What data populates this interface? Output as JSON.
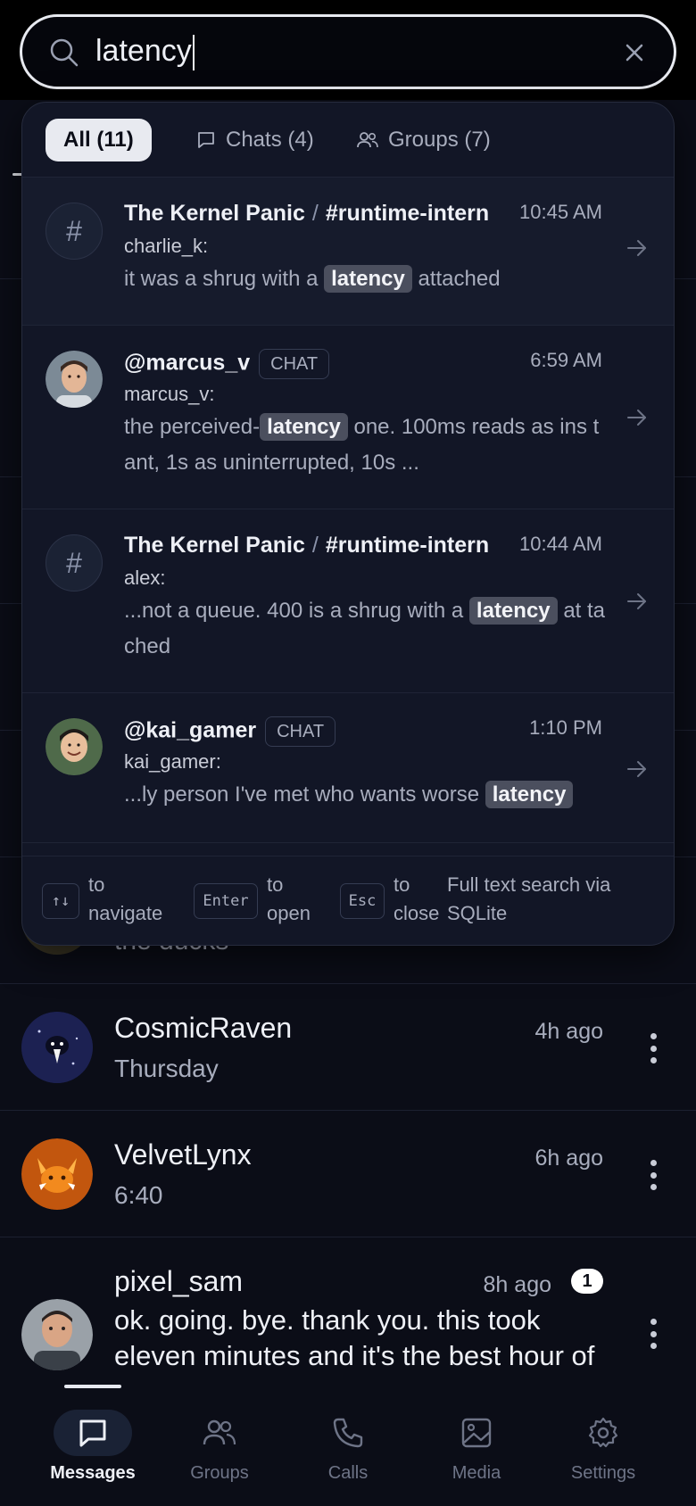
{
  "search": {
    "value": "latency",
    "placeholder": ""
  },
  "filters": [
    {
      "label": "All (11)",
      "active": true
    },
    {
      "label": "Chats (4)",
      "active": false
    },
    {
      "label": "Groups (7)",
      "active": false
    }
  ],
  "results": [
    {
      "type": "group",
      "group": "The Kernel Panic",
      "separator": "/",
      "channel": "#runtime-intern",
      "time": "10:45 AM",
      "sender": "charlie_k:",
      "before": "it was a shrug with a",
      "match": "latency",
      "after": "attached"
    },
    {
      "type": "chat",
      "name": "@marcus_v",
      "chip": "CHAT",
      "time": "6:59 AM",
      "sender": "marcus_v:",
      "before": "the perceived-",
      "match": "latency",
      "after": "one. 100ms reads as ins tant, 1s as uninterrupted, 10s ..."
    },
    {
      "type": "group",
      "group": "The Kernel Panic",
      "separator": "/",
      "channel": "#runtime-intern",
      "time": "10:44 AM",
      "sender": "alex:",
      "before": "...not a queue. 400 is a shrug with a",
      "match": "latency",
      "after": "at tached"
    },
    {
      "type": "chat",
      "name": "@kai_gamer",
      "chip": "CHAT",
      "time": "1:10 PM",
      "sender": "kai_gamer:",
      "before": "...ly person I've met who wants worse",
      "match": "latency",
      "after": ""
    }
  ],
  "shortcuts": {
    "navigate_key": "↑↓",
    "navigate_label": "to navigate",
    "open_key": "Enter",
    "open_label": "to open",
    "close_key": "Esc",
    "close_label": "to close",
    "note": "Full text search via SQLite"
  },
  "conversations": {
    "peek_text": "the ducks",
    "items": [
      {
        "name": "CosmicRaven",
        "time": "4h ago",
        "preview": "Thursday"
      },
      {
        "name": "VelvetLynx",
        "time": "6h ago",
        "preview": "6:40"
      },
      {
        "name": "pixel_sam",
        "time": "8h ago",
        "unread": "1",
        "preview": "ok. going. bye. thank you. this took eleven minutes and it's the best hour of"
      }
    ]
  },
  "nav": [
    {
      "label": "Messages",
      "icon": "message-icon",
      "active": true
    },
    {
      "label": "Groups",
      "icon": "users-icon",
      "active": false
    },
    {
      "label": "Calls",
      "icon": "phone-icon",
      "active": false
    },
    {
      "label": "Media",
      "icon": "image-icon",
      "active": false
    },
    {
      "label": "Settings",
      "icon": "gear-icon",
      "active": false
    }
  ],
  "colors": {
    "background": "#0b0d17",
    "dropdown": "#121626",
    "highlight_chip": "#4b4f5e",
    "active_pill": "#e8eaf0"
  }
}
